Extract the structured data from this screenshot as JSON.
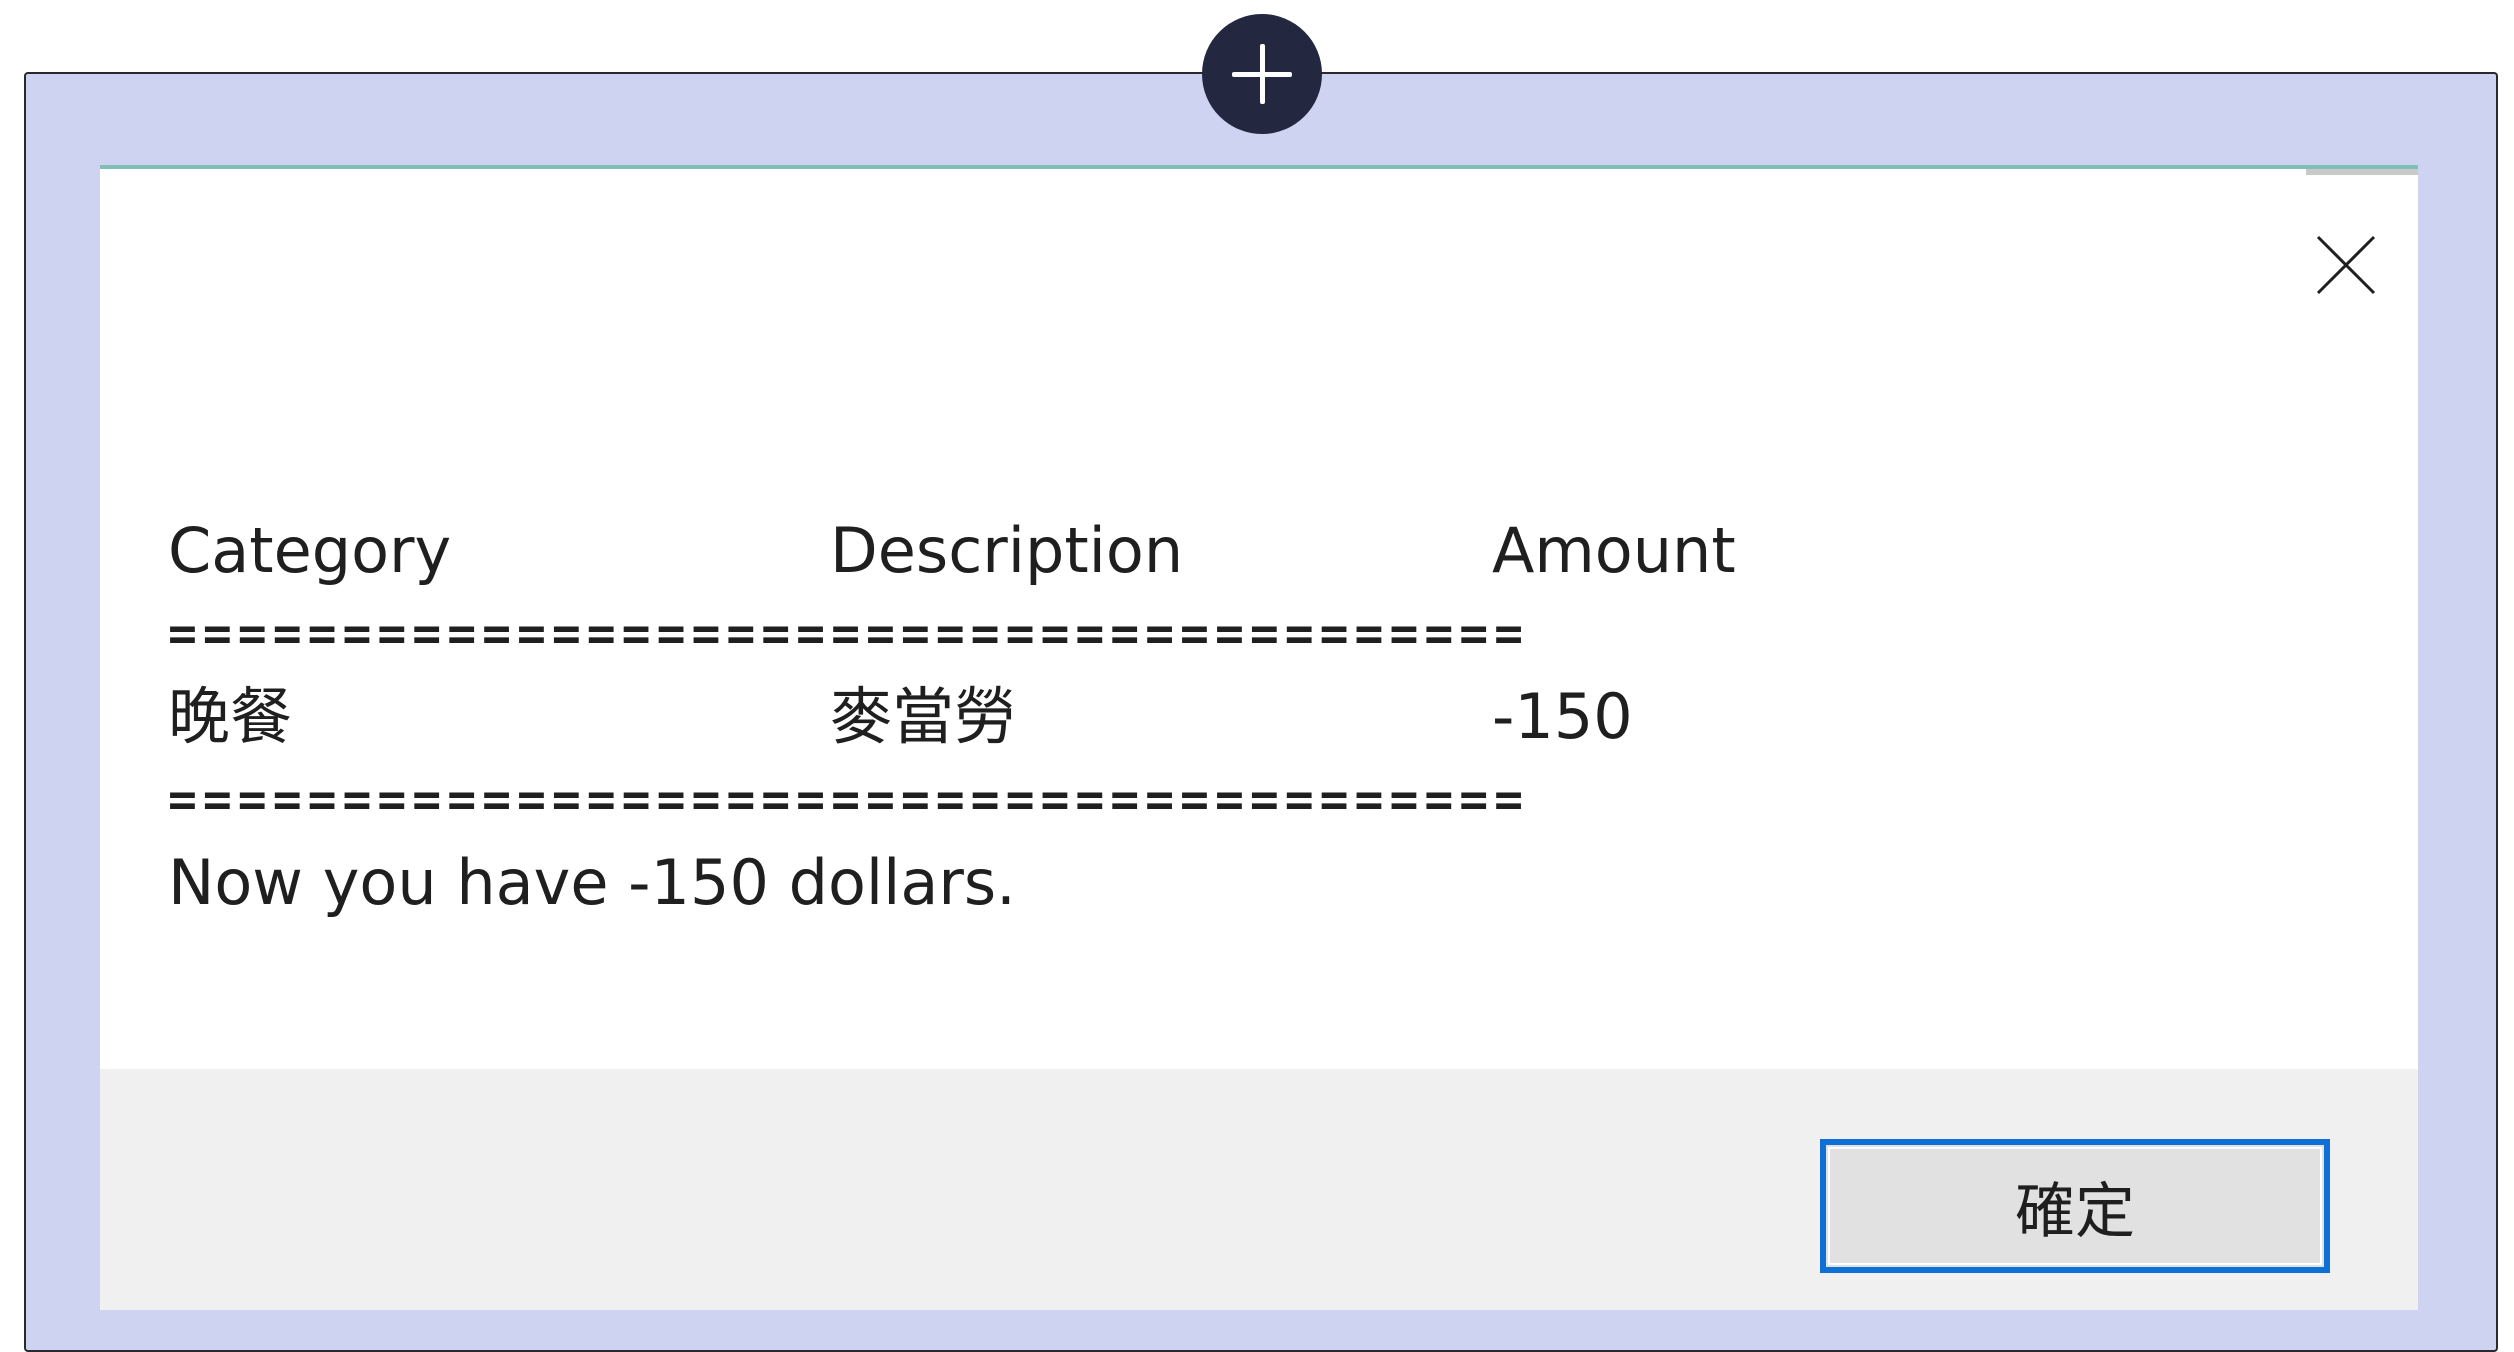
{
  "dialog": {
    "table": {
      "headers": [
        "Category",
        "Description",
        "Amount"
      ],
      "separator": "=======================================",
      "rows": [
        [
          "晚餐",
          "麥當勞",
          "-150"
        ]
      ]
    },
    "summary": "Now you have -150 dollars.",
    "ok_label": "確定",
    "icons": {
      "add": "plus-icon",
      "close": "close-icon"
    }
  },
  "colors": {
    "frame_background": "#cdd3f1",
    "add_button": "#232740",
    "accent_border": "#0e6fd6",
    "footer": "#f0f0f0"
  }
}
